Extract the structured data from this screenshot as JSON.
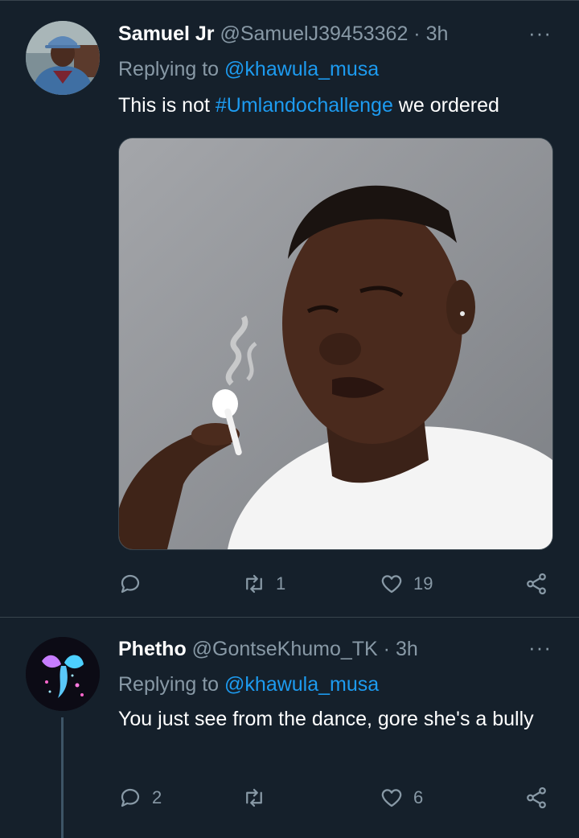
{
  "tweets": [
    {
      "name": "Samuel Jr",
      "handle": "@SamuelJ39453362",
      "separator": "·",
      "time": "3h",
      "more": "···",
      "replying_prefix": "Replying to",
      "replying_to": "@khawula_musa",
      "text_before": "This is not ",
      "hashtag": "#Umlandochallenge",
      "text_after": " we ordered",
      "replies": "",
      "retweets": "1",
      "likes": "19"
    },
    {
      "name": "Phetho",
      "handle": "@GontseKhumo_TK",
      "separator": "·",
      "time": "3h",
      "more": "···",
      "replying_prefix": "Replying to",
      "replying_to": "@khawula_musa",
      "text": "You just see from the dance, gore she's a bully",
      "replies": "2",
      "retweets": "",
      "likes": "6"
    }
  ],
  "colors": {
    "background": "#15202b",
    "link": "#1d9bf0",
    "secondary_text": "#8899a6",
    "divider": "#38444d"
  },
  "icons": [
    "reply-icon",
    "retweet-icon",
    "like-icon",
    "share-icon",
    "more-icon"
  ]
}
